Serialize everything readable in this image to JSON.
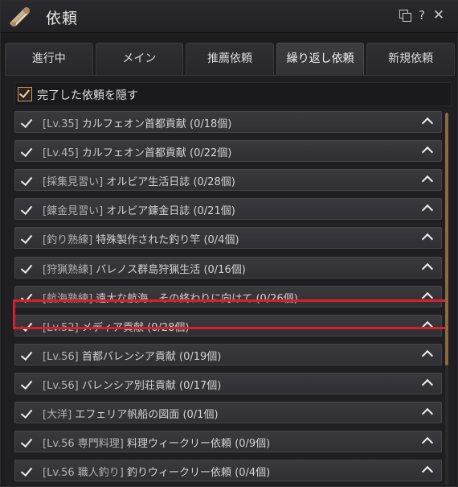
{
  "window": {
    "title": "依頼"
  },
  "titlebar": {
    "icons": [
      "scroll-icon",
      "copy-icon",
      "help-icon",
      "close-icon"
    ],
    "help_glyph": "?",
    "close_glyph": "✕"
  },
  "tabs": [
    {
      "label": "進行中",
      "active": false
    },
    {
      "label": "メイン",
      "active": false
    },
    {
      "label": "推薦依頼",
      "active": false
    },
    {
      "label": "繰り返し依頼",
      "active": true
    },
    {
      "label": "新規依頼",
      "active": false
    }
  ],
  "filter": {
    "label": "完了した依頼を隠す",
    "checked": true
  },
  "quests": [
    {
      "tag": "[Lv.35]",
      "name": "カルフェオン首都貢献",
      "progress": "(0/18個)"
    },
    {
      "tag": "[Lv.45]",
      "name": "カルフェオン首都貢献",
      "progress": "(0/22個)"
    },
    {
      "tag": "[採集見習い]",
      "name": "オルビア生活日誌",
      "progress": "(0/28個)"
    },
    {
      "tag": "[錬金見習い]",
      "name": "オルビア錬金日誌",
      "progress": "(0/21個)"
    },
    {
      "tag": "[釣り熟練]",
      "name": "特殊製作された釣り竿",
      "progress": "(0/4個)"
    },
    {
      "tag": "[狩猟熟練]",
      "name": "バレノス群島狩猟生活",
      "progress": "(0/16個)"
    },
    {
      "tag": "[航海熟練]",
      "name": "遠大な航海、その終わりに向けて",
      "progress": "(0/26個)"
    },
    {
      "tag": "[Lv.52]",
      "name": "メディア貢献",
      "progress": "(0/28個)"
    },
    {
      "tag": "[Lv.56]",
      "name": "首都バレンシア貢献",
      "progress": "(0/19個)"
    },
    {
      "tag": "[Lv.56]",
      "name": "バレンシア別荘貢献",
      "progress": "(0/17個)"
    },
    {
      "tag": "[大洋]",
      "name": "エフェリア帆船の図面",
      "progress": "(0/1個)"
    },
    {
      "tag": "[Lv.56 専門料理]",
      "name": "料理ウィークリー依頼",
      "progress": "(0/9個)"
    },
    {
      "tag": "[Lv.56 職人釣り]",
      "name": "釣りウィークリー依頼",
      "progress": "(0/4個)"
    }
  ],
  "highlighted_quest_index": 4,
  "colors": {
    "highlight": "#d8202a",
    "checkbox_accent": "#c89a58",
    "scroll_thumb": "#8a6a3e"
  }
}
